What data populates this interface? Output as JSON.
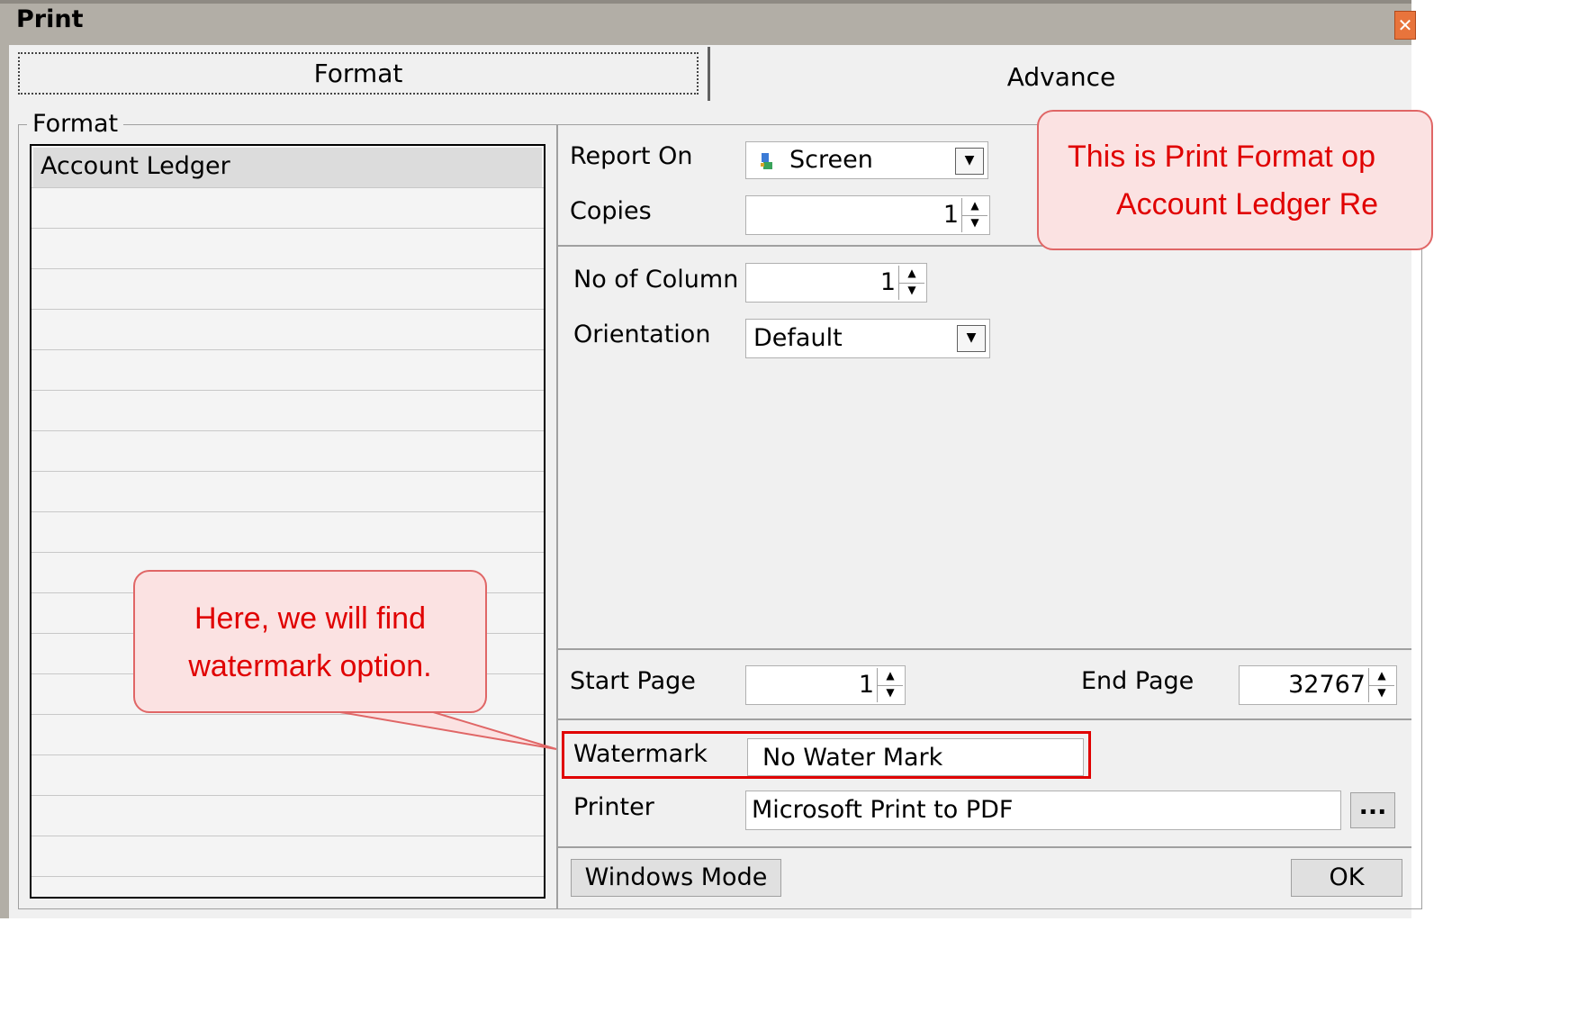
{
  "window": {
    "title": "Print",
    "close_glyph": "✕"
  },
  "tabs": [
    {
      "label": "Format",
      "active": true
    },
    {
      "label": "Advance",
      "active": false
    }
  ],
  "group": {
    "label": "Format"
  },
  "format_list": {
    "items": [
      "Account Ledger"
    ]
  },
  "report_on": {
    "label": "Report On",
    "value": "Screen",
    "icon": "screen-icon"
  },
  "copies": {
    "label": "Copies",
    "value": "1"
  },
  "no_of_column": {
    "label": "No of Column",
    "value": "1"
  },
  "orientation": {
    "label": "Orientation",
    "value": "Default"
  },
  "start_page": {
    "label": "Start Page",
    "value": "1"
  },
  "end_page": {
    "label": "End Page",
    "value": "32767"
  },
  "watermark": {
    "label": "Watermark",
    "value": "No Water Mark"
  },
  "printer": {
    "label": "Printer",
    "value": "Microsoft Print to PDF",
    "browse_label": "..."
  },
  "buttons": {
    "windows_mode": "Windows Mode",
    "ok": "OK"
  },
  "callouts": {
    "top_line1": "This is Print Format op",
    "top_line2": "Account Ledger Re",
    "bottom_line1": "Here, we will find",
    "bottom_line2": "watermark option."
  },
  "colors": {
    "callout_text": "#e00000",
    "callout_fill": "#fbe2e2",
    "highlight_border": "#e00000"
  }
}
